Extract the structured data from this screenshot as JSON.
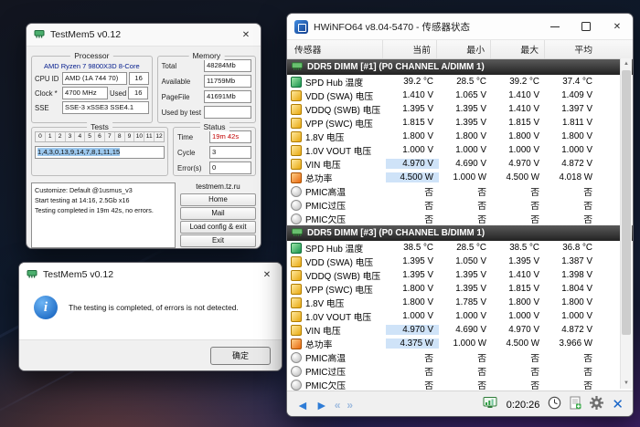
{
  "colors": {
    "accent_blue": "#2e7cd6",
    "value_highlight": "#cfe3f8",
    "error_red": "#c00000",
    "selection_blue": "#9cc8ee",
    "section_header": "#222222",
    "info_icon_blue": "#0a58b8"
  },
  "icons": {
    "close": "✕",
    "back_arrow": "◄",
    "forward_arrow": "►",
    "fast_back": "«",
    "fast_forward": "»",
    "scroll_up": "▲",
    "scroll_down": "▼",
    "info": "i"
  },
  "testmem": {
    "title": "TestMem5 v0.12",
    "processor": {
      "group_label": "Processor",
      "cpu_name": "AMD Ryzen 7 9800X3D 8-Core",
      "cpu_id_label": "CPU ID",
      "cpu_id_value": "AMD (1A 744 70)",
      "cpu_id_extra": "16",
      "clock_label": "Clock *",
      "clock_value": "4700 MHz",
      "used_label": "Used",
      "used_value": "16",
      "sse_label": "SSE",
      "sse_value": "SSE-3 xSSE3 SSE4.1"
    },
    "memory": {
      "group_label": "Memory",
      "rows": [
        {
          "label": "Total",
          "value": "48284Mb"
        },
        {
          "label": "Available",
          "value": "11759Mb"
        },
        {
          "label": "PageFile",
          "value": "41691Mb"
        },
        {
          "label": "Used by test",
          "value": ""
        }
      ]
    },
    "tests": {
      "group_label": "Tests",
      "numbers": [
        "0",
        "1",
        "2",
        "3",
        "4",
        "5",
        "6",
        "7",
        "8",
        "9",
        "10",
        "11",
        "12"
      ],
      "selection": "1,4,3,0,13,9,14,7,8,1,11,15"
    },
    "status": {
      "group_label": "Status",
      "time_label": "Time",
      "time_value": "19m 42s",
      "cycle_label": "Cycle",
      "cycle_value": "3",
      "errors_label": "Error(s)",
      "errors_value": "0"
    },
    "log_lines": [
      "Customize: Default @1usmus_v3",
      "Start testing at 14:16, 2.5Gb x16",
      "Testing completed in 19m 42s, no errors."
    ],
    "link": "testmem.tz.ru",
    "buttons": [
      "Home",
      "Mail",
      "Load config & exit",
      "Exit"
    ]
  },
  "dialog": {
    "title": "TestMem5 v0.12",
    "message": "The testing is completed, of errors is not detected.",
    "ok_label": "确定"
  },
  "hwinfo": {
    "title": "HWiNFO64 v8.04-5470 - 传感器状态",
    "columns": [
      "传感器",
      "当前",
      "最小",
      "最大",
      "平均"
    ],
    "sections": [
      {
        "header": "DDR5 DIMM [#1] (P0 CHANNEL A/DIMM 1)",
        "rows": [
          {
            "icon": "temp",
            "label": "SPD Hub 温度",
            "values": [
              "39.2 °C",
              "28.5 °C",
              "39.2 °C",
              "37.4 °C"
            ],
            "hl": []
          },
          {
            "icon": "volt",
            "label": "VDD (SWA) 电压",
            "values": [
              "1.410 V",
              "1.065 V",
              "1.410 V",
              "1.409 V"
            ],
            "hl": []
          },
          {
            "icon": "volt",
            "label": "VDDQ (SWB) 电压",
            "values": [
              "1.395 V",
              "1.395 V",
              "1.410 V",
              "1.397 V"
            ],
            "hl": []
          },
          {
            "icon": "volt",
            "label": "VPP (SWC) 电压",
            "values": [
              "1.815 V",
              "1.395 V",
              "1.815 V",
              "1.811 V"
            ],
            "hl": []
          },
          {
            "icon": "volt",
            "label": "1.8V 电压",
            "values": [
              "1.800 V",
              "1.800 V",
              "1.800 V",
              "1.800 V"
            ],
            "hl": []
          },
          {
            "icon": "volt",
            "label": "1.0V VOUT 电压",
            "values": [
              "1.000 V",
              "1.000 V",
              "1.000 V",
              "1.000 V"
            ],
            "hl": []
          },
          {
            "icon": "volt",
            "label": "VIN 电压",
            "values": [
              "4.970 V",
              "4.690 V",
              "4.970 V",
              "4.872 V"
            ],
            "hl": [
              0
            ]
          },
          {
            "icon": "power",
            "label": "总功率",
            "values": [
              "4.500 W",
              "1.000 W",
              "4.500 W",
              "4.018 W"
            ],
            "hl": [
              0
            ]
          },
          {
            "icon": "flag",
            "label": "PMIC高温",
            "values": [
              "否",
              "否",
              "否",
              "否"
            ],
            "hl": []
          },
          {
            "icon": "flag",
            "label": "PMIC过压",
            "values": [
              "否",
              "否",
              "否",
              "否"
            ],
            "hl": []
          },
          {
            "icon": "flag",
            "label": "PMIC欠压",
            "values": [
              "否",
              "否",
              "否",
              "否"
            ],
            "hl": []
          }
        ]
      },
      {
        "header": "DDR5 DIMM [#3] (P0 CHANNEL B/DIMM 1)",
        "rows": [
          {
            "icon": "temp",
            "label": "SPD Hub 温度",
            "values": [
              "38.5 °C",
              "28.5 °C",
              "38.5 °C",
              "36.8 °C"
            ],
            "hl": []
          },
          {
            "icon": "volt",
            "label": "VDD (SWA) 电压",
            "values": [
              "1.395 V",
              "1.050 V",
              "1.395 V",
              "1.387 V"
            ],
            "hl": []
          },
          {
            "icon": "volt",
            "label": "VDDQ (SWB) 电压",
            "values": [
              "1.395 V",
              "1.395 V",
              "1.410 V",
              "1.398 V"
            ],
            "hl": []
          },
          {
            "icon": "volt",
            "label": "VPP (SWC) 电压",
            "values": [
              "1.800 V",
              "1.395 V",
              "1.815 V",
              "1.804 V"
            ],
            "hl": []
          },
          {
            "icon": "volt",
            "label": "1.8V 电压",
            "values": [
              "1.800 V",
              "1.785 V",
              "1.800 V",
              "1.800 V"
            ],
            "hl": []
          },
          {
            "icon": "volt",
            "label": "1.0V VOUT 电压",
            "values": [
              "1.000 V",
              "1.000 V",
              "1.000 V",
              "1.000 V"
            ],
            "hl": []
          },
          {
            "icon": "volt",
            "label": "VIN 电压",
            "values": [
              "4.970 V",
              "4.690 V",
              "4.970 V",
              "4.872 V"
            ],
            "hl": [
              0
            ]
          },
          {
            "icon": "power",
            "label": "总功率",
            "values": [
              "4.375 W",
              "1.000 W",
              "4.500 W",
              "3.966 W"
            ],
            "hl": [
              0
            ]
          },
          {
            "icon": "flag",
            "label": "PMIC高温",
            "values": [
              "否",
              "否",
              "否",
              "否"
            ],
            "hl": []
          },
          {
            "icon": "flag",
            "label": "PMIC过压",
            "values": [
              "否",
              "否",
              "否",
              "否"
            ],
            "hl": []
          },
          {
            "icon": "flag",
            "label": "PMIC欠压",
            "values": [
              "否",
              "否",
              "否",
              "否"
            ],
            "hl": []
          }
        ]
      }
    ],
    "statusbar": {
      "time": "0:20:26"
    }
  }
}
